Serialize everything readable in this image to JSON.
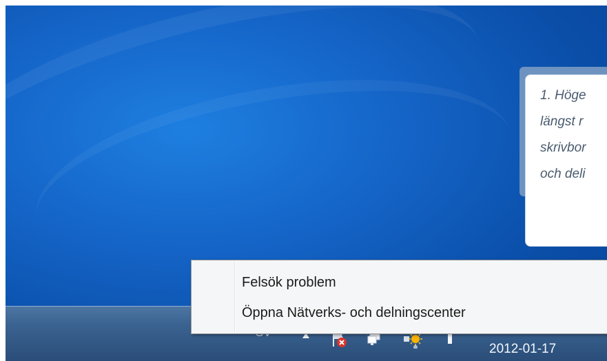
{
  "callout": {
    "lines": [
      "1. Höge",
      "längst r",
      "skrivbor",
      "och deli"
    ]
  },
  "context_menu": {
    "items": [
      {
        "label": "Felsök problem"
      },
      {
        "label": "Öppna Nätverks- och delningscenter"
      }
    ]
  },
  "taskbar": {
    "language": "SV",
    "clock_date": "2012-01-17",
    "tray_icons": [
      "show-hidden-icons-arrow-icon",
      "action-center-error-flag-icon",
      "network-icon",
      "power-icon",
      "volume-icon"
    ]
  }
}
